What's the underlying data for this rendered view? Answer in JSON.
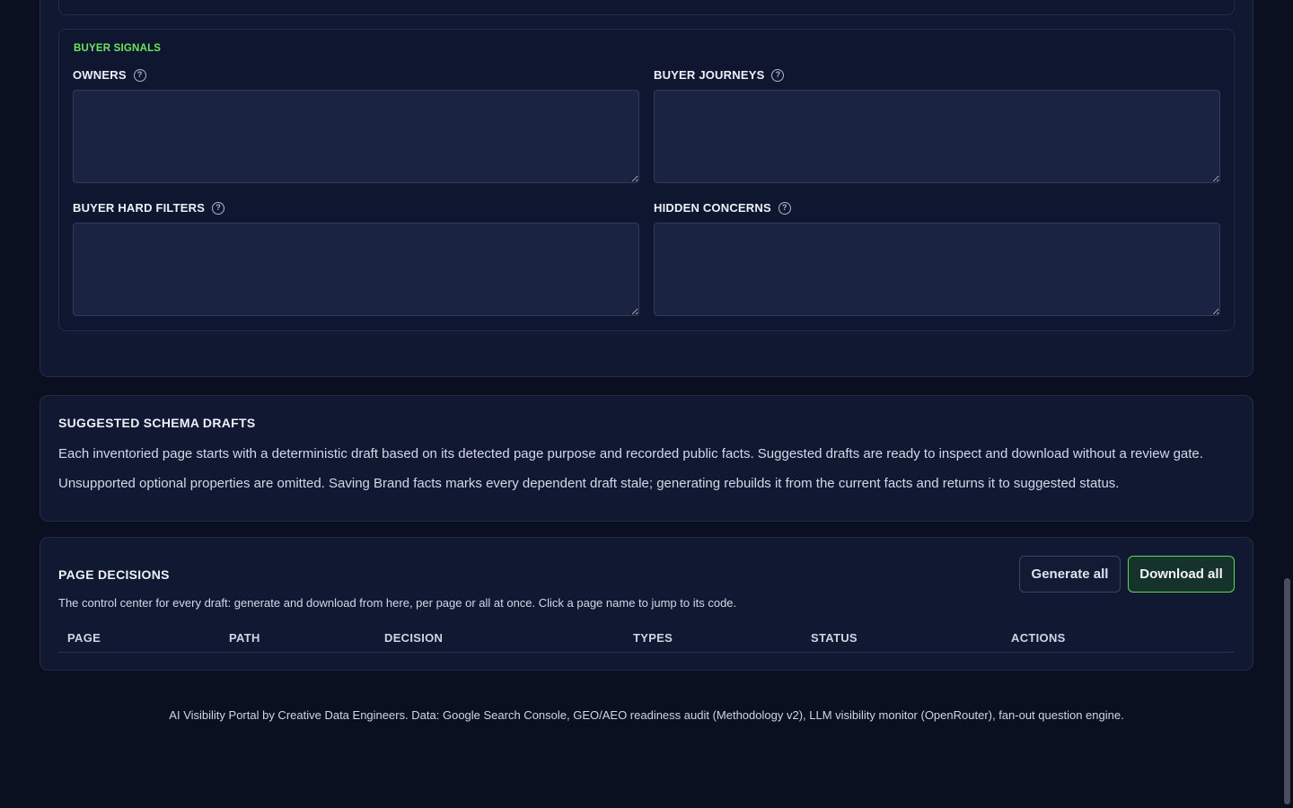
{
  "buyer_signals": {
    "title": "BUYER SIGNALS",
    "fields": [
      {
        "label": "OWNERS",
        "value": ""
      },
      {
        "label": "BUYER JOURNEYS",
        "value": ""
      },
      {
        "label": "BUYER HARD FILTERS",
        "value": ""
      },
      {
        "label": "HIDDEN CONCERNS",
        "value": ""
      }
    ]
  },
  "drafts": {
    "title": "SUGGESTED SCHEMA DRAFTS",
    "line1": "Each inventoried page starts with a deterministic draft based on its detected page purpose and recorded public facts. Suggested drafts are ready to inspect and download without a review gate.",
    "line2": "Unsupported optional properties are omitted. Saving Brand facts marks every dependent draft stale; generating rebuilds it from the current facts and returns it to suggested status."
  },
  "decisions": {
    "title": "PAGE DECISIONS",
    "description": "The control center for every draft: generate and download from here, per page or all at once. Click a page name to jump to its code.",
    "generate_label": "Generate all",
    "download_label": "Download all",
    "columns": [
      "PAGE",
      "PATH",
      "DECISION",
      "TYPES",
      "STATUS",
      "ACTIONS"
    ]
  },
  "footer": "AI Visibility Portal by Creative Data Engineers. Data: Google Search Console, GEO/AEO readiness audit (Methodology v2), LLM visibility monitor (OpenRouter), fan-out question engine.",
  "icons": {
    "help": "help-circle-icon"
  },
  "colors": {
    "accent": "#6ee65a",
    "background": "#0b1020",
    "card": "#111831"
  }
}
